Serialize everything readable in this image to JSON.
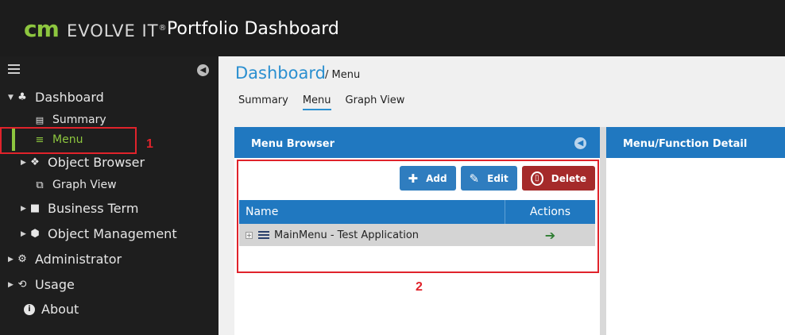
{
  "header": {
    "logo_cm": "cm",
    "logo_evolve": "EVOLVE IT",
    "logo_reg": "®",
    "title": "Portfolio Dashboard"
  },
  "sidebar": {
    "items": [
      {
        "label": "Dashboard",
        "icon": "puzzle-icon"
      },
      {
        "label": "Summary",
        "icon": "list-card-icon"
      },
      {
        "label": "Menu",
        "icon": "menu-lines-icon"
      },
      {
        "label": "Object Browser",
        "icon": "cubes-icon"
      },
      {
        "label": "Graph View",
        "icon": "clone-icon"
      },
      {
        "label": "Business Term",
        "icon": "briefcase-icon"
      },
      {
        "label": "Object Management",
        "icon": "cube-icon"
      },
      {
        "label": "Administrator",
        "icon": "gears-icon"
      },
      {
        "label": "Usage",
        "icon": "history-icon"
      },
      {
        "label": "About",
        "icon": "info-icon"
      }
    ]
  },
  "annotations": {
    "one": "1",
    "two": "2"
  },
  "breadcrumb": {
    "title": "Dashboard",
    "sub": "/ Menu"
  },
  "tabs": [
    "Summary",
    "Menu",
    "Graph View"
  ],
  "menu_browser": {
    "title": "Menu Browser",
    "buttons": {
      "add": "Add",
      "edit": "Edit",
      "delete": "Delete"
    },
    "columns": {
      "name": "Name",
      "actions": "Actions"
    },
    "rows": [
      {
        "name": "MainMenu - Test Application"
      }
    ]
  },
  "detail_panel": {
    "title": "Menu/Function Detail"
  },
  "colors": {
    "accent_green": "#8dc63f",
    "primary_blue": "#2078c0",
    "danger_red": "#a52a2a",
    "annotation_red": "#e0232b"
  }
}
